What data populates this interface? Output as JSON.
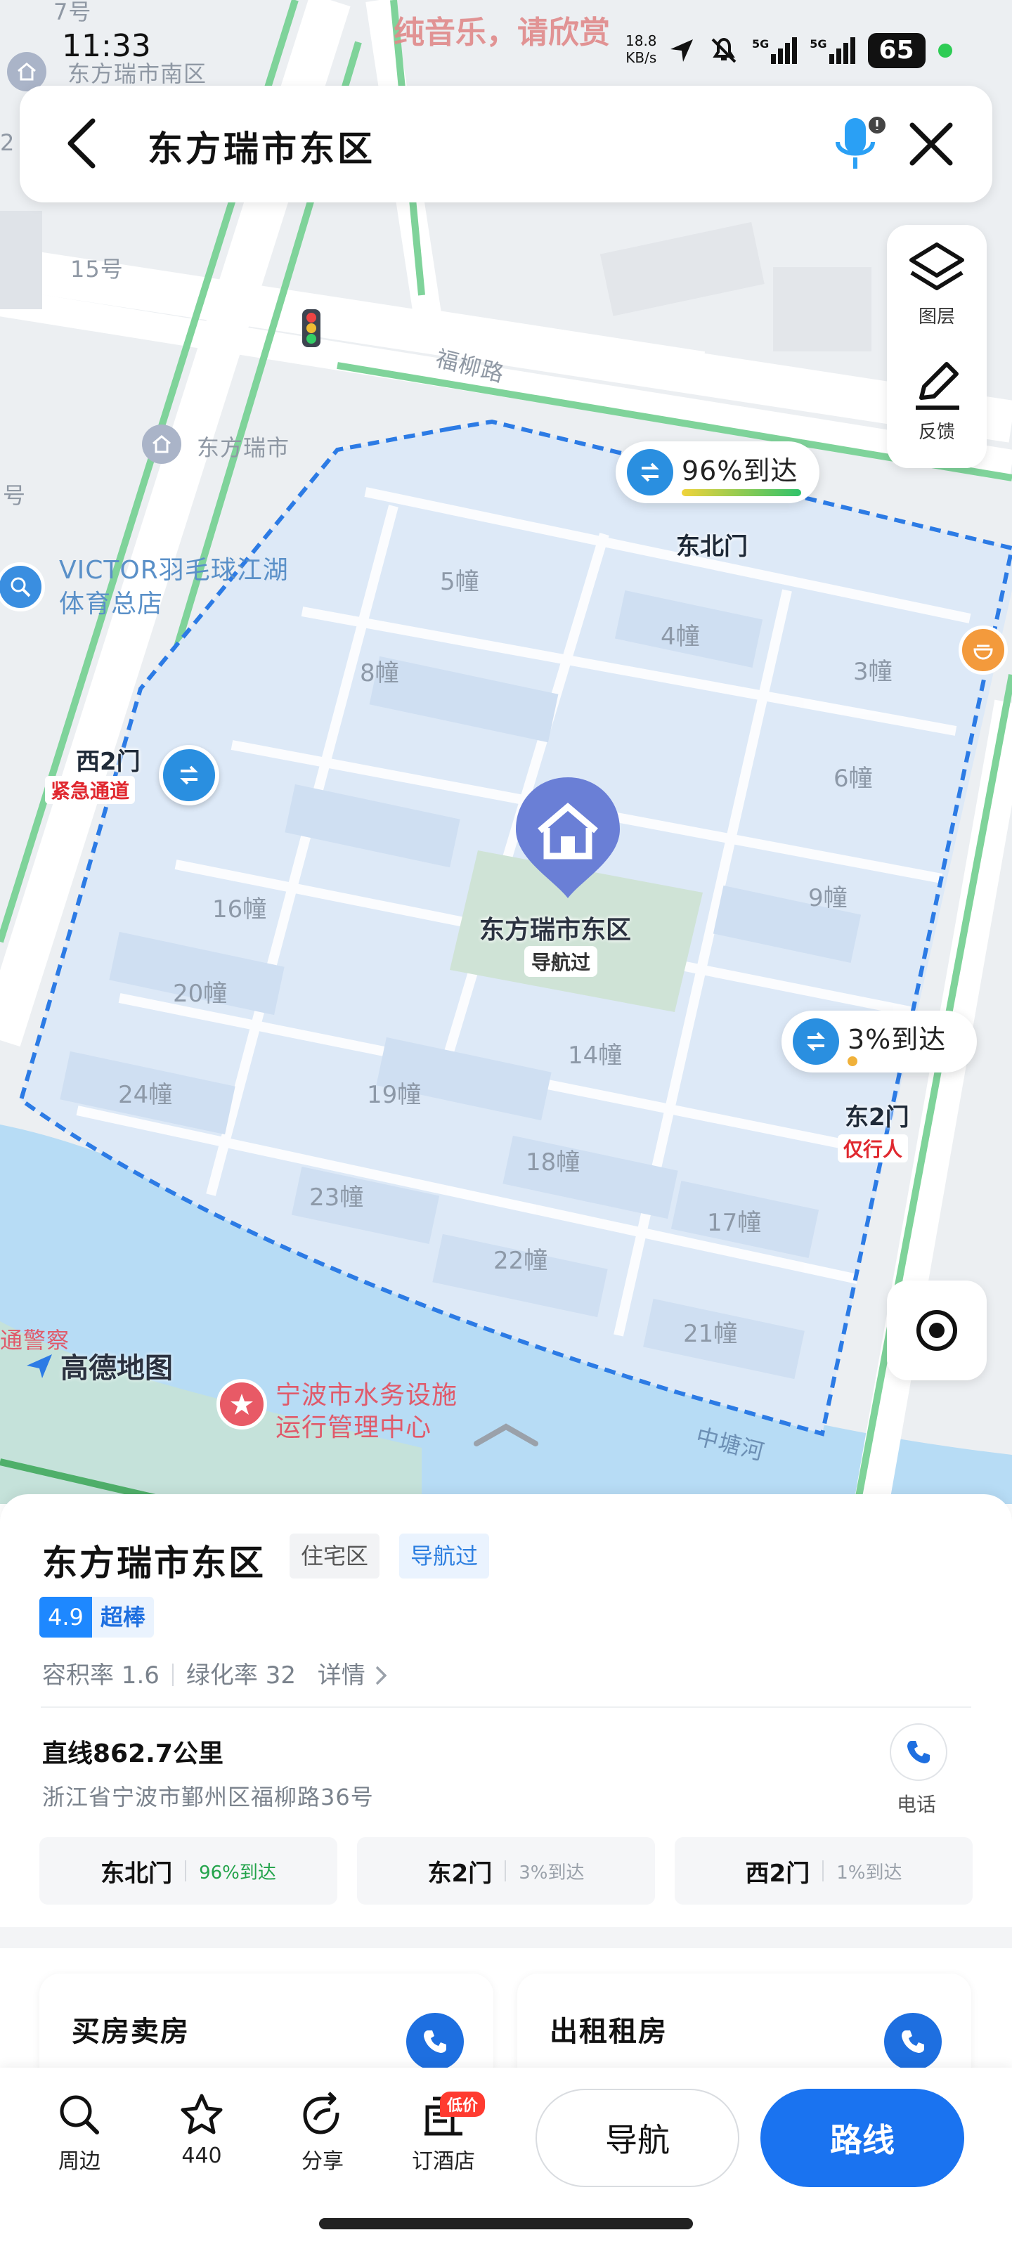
{
  "status_bar": {
    "time": "11:33",
    "marquee": "纯音乐，请欣赏",
    "net_speed_value": "18.8",
    "net_speed_unit": "KB/s",
    "signal_1": "5G",
    "signal_2": "5G",
    "battery": "65"
  },
  "search": {
    "query": "东方瑞市东区"
  },
  "tools": {
    "layers_label": "图层",
    "feedback_label": "反馈"
  },
  "map": {
    "labels": {
      "house_7": "7号",
      "house_15": "15号",
      "south_area": "东方瑞市南区",
      "dongfang_ruishi": "东方瑞市",
      "fuliu_road": "福柳路",
      "victor_line1": "VICTOR羽毛球江湖",
      "victor_line2": "体育总店",
      "water_line1": "宁波市水务设施",
      "water_line2": "运行管理中心",
      "zhongtang_river": "中塘河",
      "police": "通警察",
      "hao": "号",
      "edge_2": "2"
    },
    "buildings": [
      "5幢",
      "4幢",
      "8幢",
      "3幢",
      "6幢",
      "9幢",
      "16幢",
      "20幢",
      "14幢",
      "24幢",
      "19幢",
      "18幢",
      "17幢",
      "23幢",
      "22幢",
      "21幢"
    ],
    "pin": {
      "title": "东方瑞市东区",
      "tag": "导航过"
    },
    "gates": {
      "northeast": {
        "pct": "96%到达",
        "name": "东北门"
      },
      "east2": {
        "pct": "3%到达",
        "name": "东2门",
        "warn": "仅行人"
      },
      "west2": {
        "name": "西2门",
        "warn": "紧急通道"
      }
    },
    "brand": "高德地图",
    "colors": {
      "boundary": "#2c7be5",
      "area_fill": "#dde9f7",
      "water": "#b7dcf5",
      "road_green": "#7fd39a"
    }
  },
  "sheet": {
    "title": "东方瑞市东区",
    "tag_type": "住宅区",
    "tag_nav": "导航过",
    "rating_score": "4.9",
    "rating_word": "超棒",
    "plot_ratio": "容积率 1.6",
    "green_ratio": "绿化率 32",
    "details": "详情",
    "distance": "直线862.7公里",
    "address": "浙江省宁波市鄞州区福柳路36号",
    "call_label": "电话",
    "gate_boxes": [
      {
        "name": "东北门",
        "pct": "96%到达"
      },
      {
        "name": "东2门",
        "pct": "3%到达"
      },
      {
        "name": "西2门",
        "pct": "1%到达"
      }
    ],
    "cards": [
      {
        "title": "买房卖房"
      },
      {
        "title": "出租租房"
      }
    ]
  },
  "bottom_bar": {
    "nearby": "周边",
    "favorites_count": "440",
    "share": "分享",
    "hotel": "订酒店",
    "hotel_badge": "低价",
    "navigate": "导航",
    "route": "路线"
  }
}
